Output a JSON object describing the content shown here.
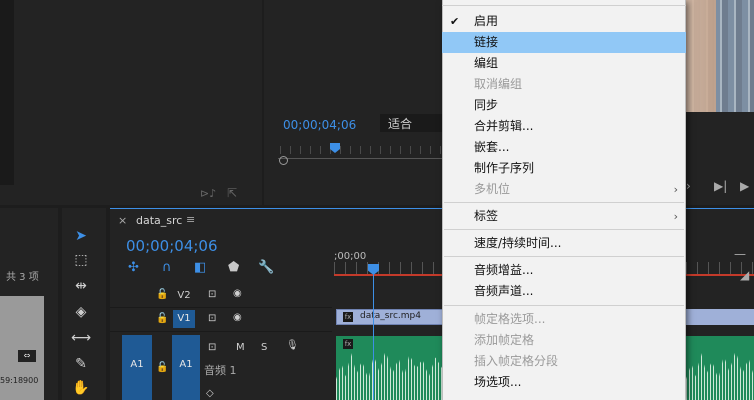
{
  "program_monitor": {
    "timecode": "00;00;04;06",
    "fit_label": "适合"
  },
  "project": {
    "item_count": "共 3 项",
    "duration": "59:18900"
  },
  "timeline": {
    "sequence_name": "data_src",
    "timecode": "00;00;04;06",
    "ruler_start": ";00;00",
    "tracks": {
      "v2": "V2",
      "v1": "V1",
      "a1_source": "A1",
      "a1": "A1",
      "audio_name": "音频 1",
      "mute": "M",
      "solo": "S"
    },
    "clip_name": "data_src.mp4",
    "fx_label": "fx"
  },
  "context_menu": {
    "items": [
      {
        "label": "启用",
        "checked": true
      },
      {
        "label": "链接",
        "hover": true
      },
      {
        "label": "编组"
      },
      {
        "label": "取消编组",
        "disabled": true
      },
      {
        "label": "同步"
      },
      {
        "label": "合并剪辑..."
      },
      {
        "label": "嵌套..."
      },
      {
        "label": "制作子序列"
      },
      {
        "label": "多机位",
        "disabled": true,
        "submenu": true
      },
      {
        "label": "标签",
        "submenu": true
      },
      {
        "label": "速度/持续时间..."
      },
      {
        "label": "音频增益..."
      },
      {
        "label": "音频声道..."
      },
      {
        "label": "帧定格选项...",
        "disabled": true
      },
      {
        "label": "添加帧定格",
        "disabled": true
      },
      {
        "label": "插入帧定格分段",
        "disabled": true
      },
      {
        "label": "场选项..."
      }
    ]
  },
  "colors": {
    "accent": "#3d8fe6",
    "menu_hover": "#91c8f6",
    "audio_clip": "#1f8a5a",
    "video_clip": "#9fb0d8",
    "ruler_red": "#c43a2a"
  }
}
